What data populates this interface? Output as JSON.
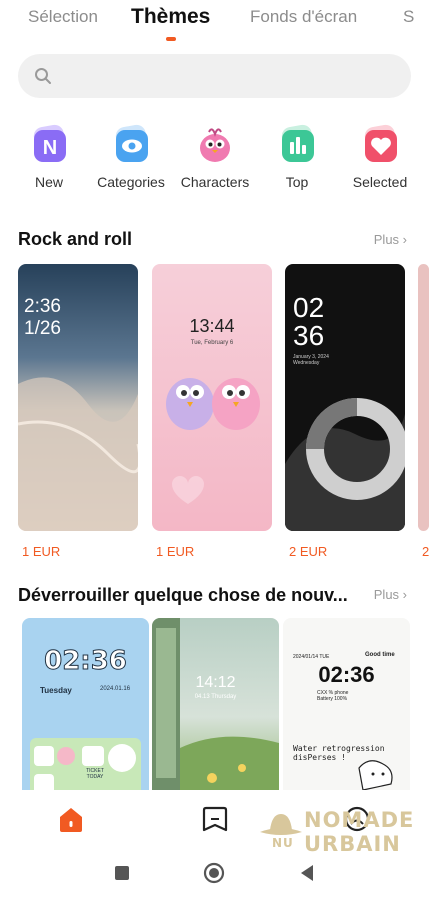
{
  "tabs": [
    {
      "label": "Sélection"
    },
    {
      "label": "Thèmes"
    },
    {
      "label": "Fonds d'écran"
    },
    {
      "label": "S"
    }
  ],
  "search": {
    "placeholder": ""
  },
  "categories": [
    {
      "label": "New",
      "icon": "n-icon",
      "color": "#8a6cf5"
    },
    {
      "label": "Categories",
      "icon": "eye-icon",
      "color": "#4aa3f0"
    },
    {
      "label": "Characters",
      "icon": "bird-character-icon",
      "color": "#f07ab0"
    },
    {
      "label": "Top",
      "icon": "bar-chart-icon",
      "color": "#3cc796"
    },
    {
      "label": "Selected",
      "icon": "heart-icon",
      "color": "#f0506a"
    }
  ],
  "section1": {
    "title": "Rock and roll",
    "more": "Plus ›",
    "themes": [
      {
        "time": "2:36",
        "date": "1/26",
        "price": "1 EUR"
      },
      {
        "time": "13:44",
        "date": "Tue, February 6",
        "price": "1 EUR"
      },
      {
        "time": "02\n36",
        "date": "January 3, 2024\nWednesday",
        "price": "2 EUR"
      },
      {
        "price": "2"
      }
    ]
  },
  "section2": {
    "title": "Déverrouiller quelque chose de nouv...",
    "more": "Plus ›",
    "themes": [
      {
        "time": "02:36",
        "day": "Tuesday",
        "date": "2024.01.16",
        "tag": "TICKET TODAY"
      },
      {
        "time": "14:12",
        "date": "04.13 Thursday"
      },
      {
        "time": "02:36",
        "date": "2024/01/14 TUE",
        "greeting": "Good time",
        "battery": "CXX % phone\nBattery 100%",
        "note": "Water retrogression\ndisPerses !"
      }
    ]
  },
  "bottom_nav": [
    {
      "icon": "home-icon",
      "active": true
    },
    {
      "icon": "bookmark-icon",
      "active": false
    },
    {
      "icon": "profile-icon",
      "active": false
    }
  ],
  "system_nav": [
    {
      "icon": "recents-square-icon"
    },
    {
      "icon": "home-circle-icon"
    },
    {
      "icon": "back-triangle-icon"
    }
  ],
  "watermark": {
    "line1": "NOMADE",
    "line2": "URBAIN",
    "prefix": "NU"
  },
  "colors": {
    "accent": "#f15a22"
  }
}
